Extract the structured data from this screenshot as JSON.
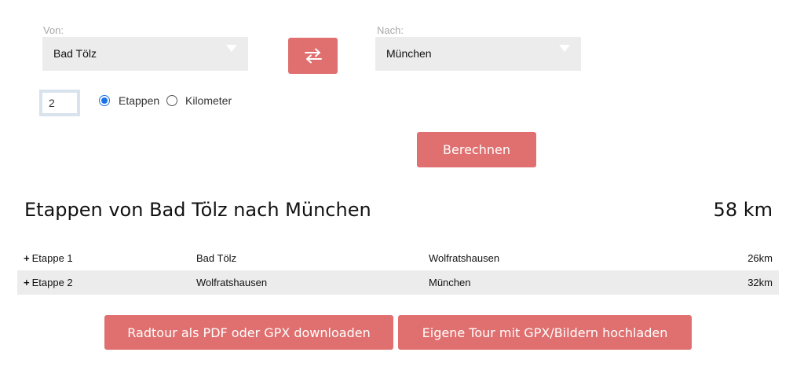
{
  "route": {
    "from_label": "Von:",
    "from_value": "Bad Tölz",
    "to_label": "Nach:",
    "to_value": "München"
  },
  "options": {
    "stages_value": "2",
    "mode_stages_label": "Etappen",
    "mode_km_label": "Kilometer",
    "selected_mode": "Etappen"
  },
  "actions": {
    "calculate_label": "Berechnen",
    "download_label": "Radtour als PDF oder GPX downloaden",
    "upload_label": "Eigene Tour mit GPX/Bildern hochladen"
  },
  "result": {
    "title": "Etappen von Bad Tölz nach München",
    "total": "58 km",
    "stages": [
      {
        "expand": "+",
        "name": "Etappe 1",
        "from": "Bad Tölz",
        "to": "Wolfratshausen",
        "distance": "26km"
      },
      {
        "expand": "+",
        "name": "Etappe 2",
        "from": "Wolfratshausen",
        "to": "München",
        "distance": "32km"
      }
    ]
  },
  "colors": {
    "accent": "#e06f6f",
    "select_bg": "#ececec",
    "radio_active": "#1a73e8"
  },
  "icons": {
    "swap": "swap-arrows-icon",
    "dropdown": "chevron-down-icon"
  }
}
